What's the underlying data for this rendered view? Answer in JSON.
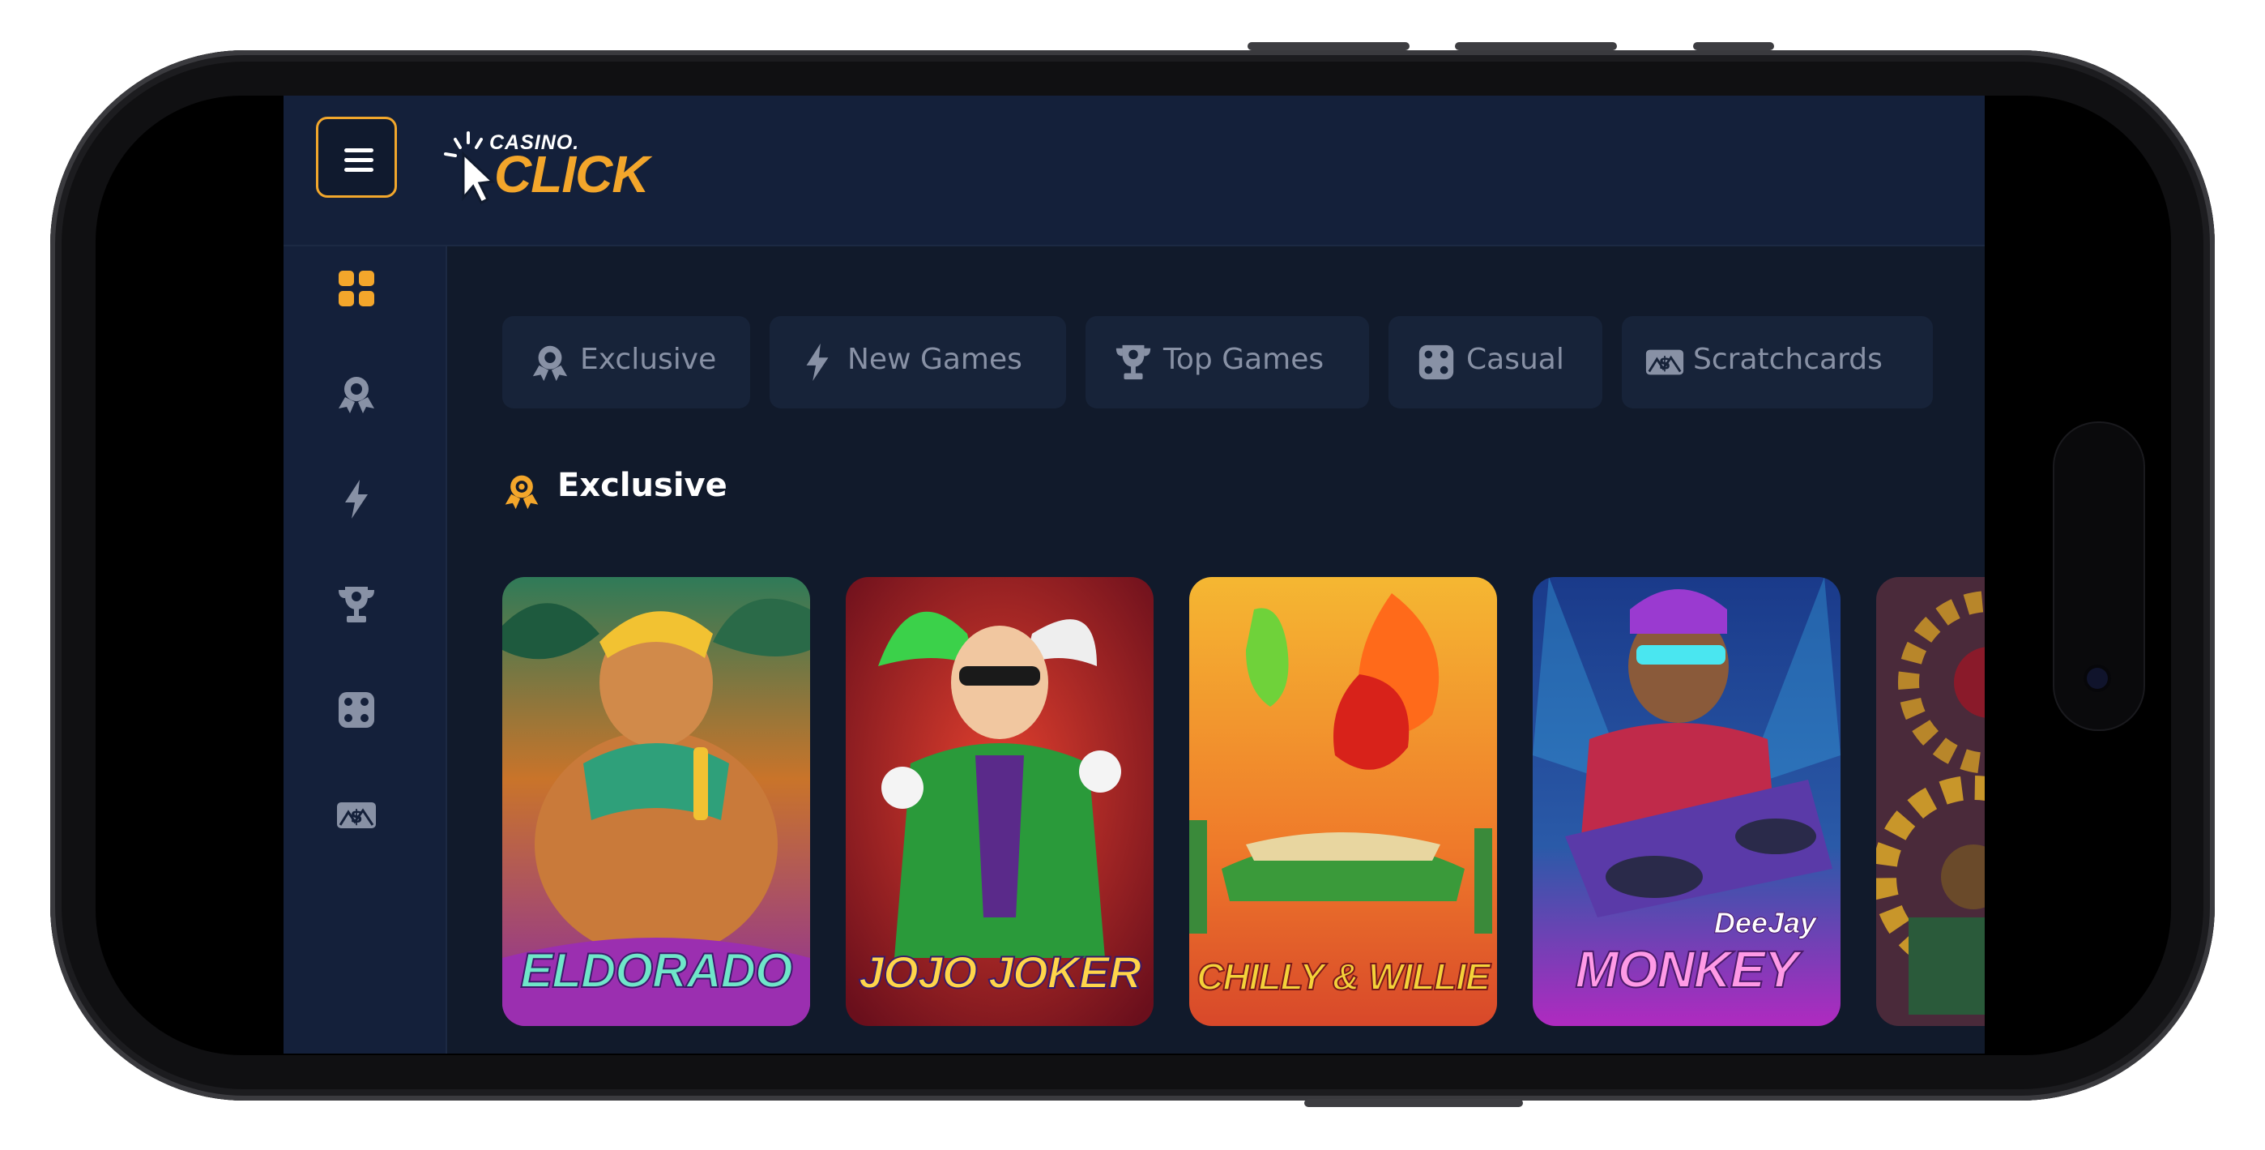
{
  "brand": {
    "logo_small": "CASINO.",
    "logo_big": "CLICK",
    "accent": "#f3a62b"
  },
  "topbar": {
    "menu_icon": "hamburger-icon"
  },
  "sidebar": {
    "items": [
      {
        "icon": "grid-icon",
        "active": true
      },
      {
        "icon": "award-icon",
        "active": false
      },
      {
        "icon": "lightning-icon",
        "active": false
      },
      {
        "icon": "trophy-icon",
        "active": false
      },
      {
        "icon": "dice-icon",
        "active": false
      },
      {
        "icon": "scratchcard-icon",
        "active": false
      }
    ]
  },
  "categories": [
    {
      "label": "Exclusive",
      "icon": "award-icon"
    },
    {
      "label": "New Games",
      "icon": "lightning-icon"
    },
    {
      "label": "Top Games",
      "icon": "trophy-icon"
    },
    {
      "label": "Casual",
      "icon": "dice-icon"
    },
    {
      "label": "Scratchcards",
      "icon": "scratchcard-icon"
    }
  ],
  "section": {
    "title": "Exclusive",
    "icon": "award-icon"
  },
  "games": [
    {
      "title": "ELDORADO",
      "subtitle": ""
    },
    {
      "title": "JOJO JOKER",
      "subtitle": ""
    },
    {
      "title": "CHILLY & WILLIE",
      "subtitle": ""
    },
    {
      "title": "MONKEY",
      "subtitle": "DeeJay"
    },
    {
      "title": "",
      "subtitle": ""
    }
  ]
}
